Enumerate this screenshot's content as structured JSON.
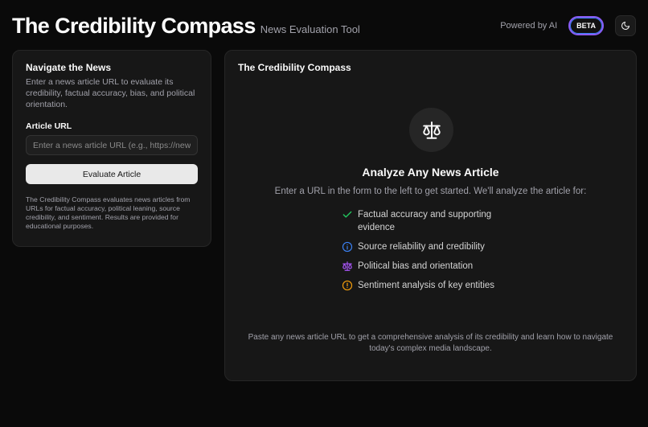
{
  "header": {
    "title": "The Credibility Compass",
    "subtitle": "News Evaluation Tool",
    "powered": "Powered by AI",
    "badge": "BETA"
  },
  "left": {
    "title": "Navigate the News",
    "description": "Enter a news article URL to evaluate its credibility, factual accuracy, bias, and political orientation.",
    "field_label": "Article URL",
    "input_value": "",
    "input_placeholder": "Enter a news article URL (e.g., https://news",
    "button_label": "Evaluate Article",
    "note": "The Credibility Compass evaluates news articles from URLs for factual accuracy, political leaning, source credibility, and sentiment. Results are provided for educational purposes."
  },
  "right": {
    "title": "The Credibility Compass",
    "icon": "scale-icon",
    "heading": "Analyze Any News Article",
    "subheading": "Enter a URL in the form to the left to get started. We'll analyze the article for:",
    "features": [
      {
        "icon": "check-icon",
        "color": "#22c55e",
        "label": "Factual accuracy and supporting evidence"
      },
      {
        "icon": "info-icon",
        "color": "#3b82f6",
        "label": "Source reliability and credibility"
      },
      {
        "icon": "scale-icon",
        "color": "#a855f7",
        "label": "Political bias and orientation"
      },
      {
        "icon": "alert-icon",
        "color": "#f59e0b",
        "label": "Sentiment analysis of key entities"
      }
    ],
    "footer": "Paste any news article URL to get a comprehensive analysis of its credibility and learn how to navigate today's complex media landscape."
  },
  "colors": {
    "background": "#0a0a0a",
    "card": "#171717",
    "badge_border": "#8b5cf6"
  }
}
